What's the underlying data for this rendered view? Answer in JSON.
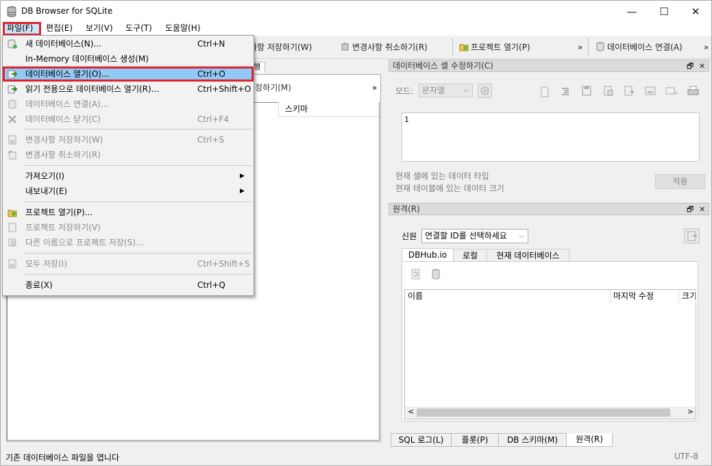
{
  "window": {
    "title": "DB Browser for SQLite",
    "minimize": "—",
    "maximize": "☐",
    "close": "✕"
  },
  "menubar": {
    "items": [
      {
        "label": "파일(F)",
        "active": true
      },
      {
        "label": "편집(E)"
      },
      {
        "label": "보기(V)"
      },
      {
        "label": "도구(T)"
      },
      {
        "label": "도움말(H)"
      }
    ]
  },
  "toolbar": {
    "save_changes": "사항 저장하기(W)",
    "revert_changes": "변경사항 취소하기(R)",
    "open_project": "프로젝트 열기(P)",
    "more1": "»",
    "attach_db": "데이터베이스 연결(A)",
    "more2": "»"
  },
  "left_panel": {
    "tab_fragment": "행",
    "subtoolbar_text": "수정하기(M)",
    "subtoolbar_more": "»",
    "column_schema": "스키마"
  },
  "edit_cell_dock": {
    "title": "데이터베이스 셀 수정하기(C)",
    "mode_label": "모드:",
    "mode_value": "문자열",
    "cell_value": "1",
    "type_info": "현재 셀에 있는 데이터 타입",
    "size_info": "현재 테이블에 있는 데이터 크기",
    "apply_button": "적용"
  },
  "remote_dock": {
    "title": "원격(R)",
    "identity_label": "신원",
    "identity_value": "연결할 ID를 선택하세요",
    "tabs": [
      "DBHub.io",
      "로컬",
      "현재 데이터베이스"
    ],
    "columns": [
      "이름",
      "마지막 수정",
      "크기"
    ]
  },
  "bottom_tabs": [
    "SQL 로그(L)",
    "플롯(P)",
    "DB 스키마(M)",
    "원격(R)"
  ],
  "statusbar": {
    "message": "기존 데이터베이스 파일을 엽니다",
    "encoding": "UTF-8"
  },
  "file_menu": {
    "items": [
      {
        "label": "새 데이터베이스(N)...",
        "shortcut": "Ctrl+N",
        "icon": "new-db-icon",
        "disabled": false
      },
      {
        "label": "In-Memory 데이터베이스 생성(M)",
        "shortcut": "",
        "icon": "",
        "disabled": false
      },
      {
        "label": "데이터베이스 열기(O)...",
        "shortcut": "Ctrl+O",
        "icon": "open-db-icon",
        "disabled": false,
        "highlighted": true
      },
      {
        "label": "읽기 전용으로 데이터베이스 열기(R)...",
        "shortcut": "Ctrl+Shift+O",
        "icon": "open-readonly-icon",
        "disabled": false
      },
      {
        "label": "데이터베이스 연결(A)...",
        "shortcut": "",
        "icon": "attach-db-icon",
        "disabled": true
      },
      {
        "label": "데이터베이스 닫기(C)",
        "shortcut": "Ctrl+F4",
        "icon": "close-db-icon",
        "disabled": true
      },
      {
        "label": "변경사항 저장하기(W)",
        "shortcut": "Ctrl+S",
        "icon": "save-icon",
        "disabled": true
      },
      {
        "label": "변경사항 취소하기(R)",
        "shortcut": "",
        "icon": "revert-icon",
        "disabled": true
      },
      {
        "label": "가져오기(I)",
        "shortcut": "",
        "icon": "",
        "disabled": false,
        "submenu": true
      },
      {
        "label": "내보내기(E)",
        "shortcut": "",
        "icon": "",
        "disabled": false,
        "submenu": true
      },
      {
        "label": "프로젝트 열기(P)...",
        "shortcut": "",
        "icon": "open-project-icon",
        "disabled": false
      },
      {
        "label": "프로젝트 저장하기(V)",
        "shortcut": "",
        "icon": "save-project-icon",
        "disabled": true
      },
      {
        "label": "다른 이름으로 프로젝트 저장(S)...",
        "shortcut": "",
        "icon": "save-project-as-icon",
        "disabled": true
      },
      {
        "label": "모두 저장(I)",
        "shortcut": "Ctrl+Shift+S",
        "icon": "save-all-icon",
        "disabled": true
      },
      {
        "label": "종료(X)",
        "shortcut": "Ctrl+Q",
        "icon": "",
        "disabled": false
      }
    ],
    "submenu_arrow": "▶"
  },
  "colors": {
    "highlight": "#91c9f7",
    "annotation_red": "#e0202a"
  }
}
